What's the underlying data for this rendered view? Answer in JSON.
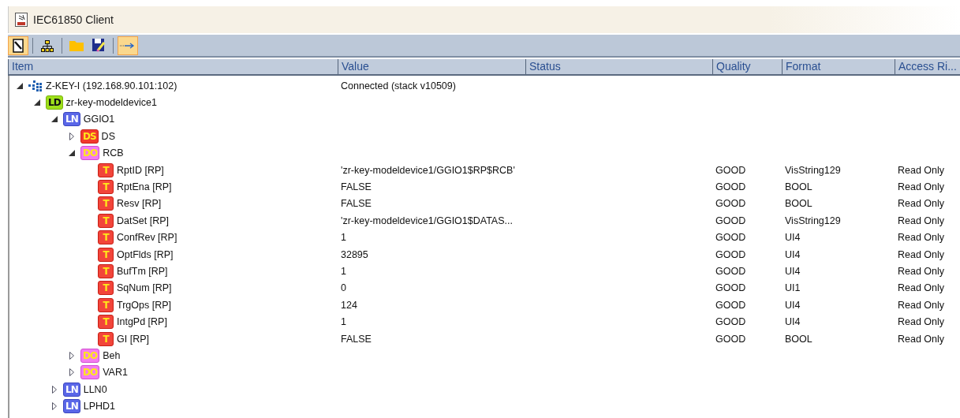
{
  "window": {
    "title": "IEC61850 Client"
  },
  "toolbar": [
    {
      "kind": "connect",
      "selected": true
    },
    {
      "kind": "network",
      "selected": false
    },
    {
      "kind": "open",
      "selected": false
    },
    {
      "kind": "save",
      "selected": false
    },
    {
      "kind": "arrow",
      "selected": true
    }
  ],
  "table": {
    "columns": [
      "Item",
      "Value",
      "Status",
      "Quality",
      "Format",
      "Access Ri..."
    ],
    "tree": [
      {
        "kind": "server",
        "label": "Z-KEY-I (192.168.90.101:102)",
        "value": "Connected (stack v10509)",
        "expanded": true,
        "children": [
          {
            "kind": "ld",
            "badge": "LD",
            "label": "zr-key-modeldevice1",
            "expanded": true,
            "children": [
              {
                "kind": "ln",
                "badge": "LN",
                "label": "GGIO1",
                "expanded": true,
                "children": [
                  {
                    "kind": "ds",
                    "badge": "DS",
                    "label": "DS",
                    "expanded": false
                  },
                  {
                    "kind": "do",
                    "badge": "DO",
                    "label": "RCB",
                    "expanded": true,
                    "children": [
                      {
                        "kind": "t",
                        "badge": "T",
                        "label": "RptID [RP]",
                        "value": "'zr-key-modeldevice1/GGIO1$RP$RCB'",
                        "quality": "GOOD",
                        "format": "VisString129",
                        "access": "Read Only"
                      },
                      {
                        "kind": "t",
                        "badge": "T",
                        "label": "RptEna [RP]",
                        "value": "FALSE",
                        "quality": "GOOD",
                        "format": "BOOL",
                        "access": "Read Only"
                      },
                      {
                        "kind": "t",
                        "badge": "T",
                        "label": "Resv [RP]",
                        "value": "FALSE",
                        "quality": "GOOD",
                        "format": "BOOL",
                        "access": "Read Only"
                      },
                      {
                        "kind": "t",
                        "badge": "T",
                        "label": "DatSet [RP]",
                        "value": "'zr-key-modeldevice1/GGIO1$DATAS...",
                        "quality": "GOOD",
                        "format": "VisString129",
                        "access": "Read Only"
                      },
                      {
                        "kind": "t",
                        "badge": "T",
                        "label": "ConfRev [RP]",
                        "value": "1",
                        "quality": "GOOD",
                        "format": "UI4",
                        "access": "Read Only"
                      },
                      {
                        "kind": "t",
                        "badge": "T",
                        "label": "OptFlds [RP]",
                        "value": "32895",
                        "quality": "GOOD",
                        "format": "UI4",
                        "access": "Read Only"
                      },
                      {
                        "kind": "t",
                        "badge": "T",
                        "label": "BufTm [RP]",
                        "value": "1",
                        "quality": "GOOD",
                        "format": "UI4",
                        "access": "Read Only"
                      },
                      {
                        "kind": "t",
                        "badge": "T",
                        "label": "SqNum [RP]",
                        "value": "0",
                        "quality": "GOOD",
                        "format": "UI1",
                        "access": "Read Only"
                      },
                      {
                        "kind": "t",
                        "badge": "T",
                        "label": "TrgOps [RP]",
                        "value": "124",
                        "quality": "GOOD",
                        "format": "UI4",
                        "access": "Read Only"
                      },
                      {
                        "kind": "t",
                        "badge": "T",
                        "label": "IntgPd [RP]",
                        "value": "1",
                        "quality": "GOOD",
                        "format": "UI4",
                        "access": "Read Only"
                      },
                      {
                        "kind": "t",
                        "badge": "T",
                        "label": "GI [RP]",
                        "value": "FALSE",
                        "quality": "GOOD",
                        "format": "BOOL",
                        "access": "Read Only"
                      }
                    ]
                  },
                  {
                    "kind": "do",
                    "badge": "DO",
                    "label": "Beh",
                    "expanded": false
                  },
                  {
                    "kind": "do",
                    "badge": "DO",
                    "label": "VAR1",
                    "expanded": false
                  }
                ]
              },
              {
                "kind": "ln",
                "badge": "LN",
                "label": "LLN0",
                "expanded": false
              },
              {
                "kind": "ln",
                "badge": "LN",
                "label": "LPHD1",
                "expanded": false
              }
            ]
          }
        ]
      }
    ]
  }
}
